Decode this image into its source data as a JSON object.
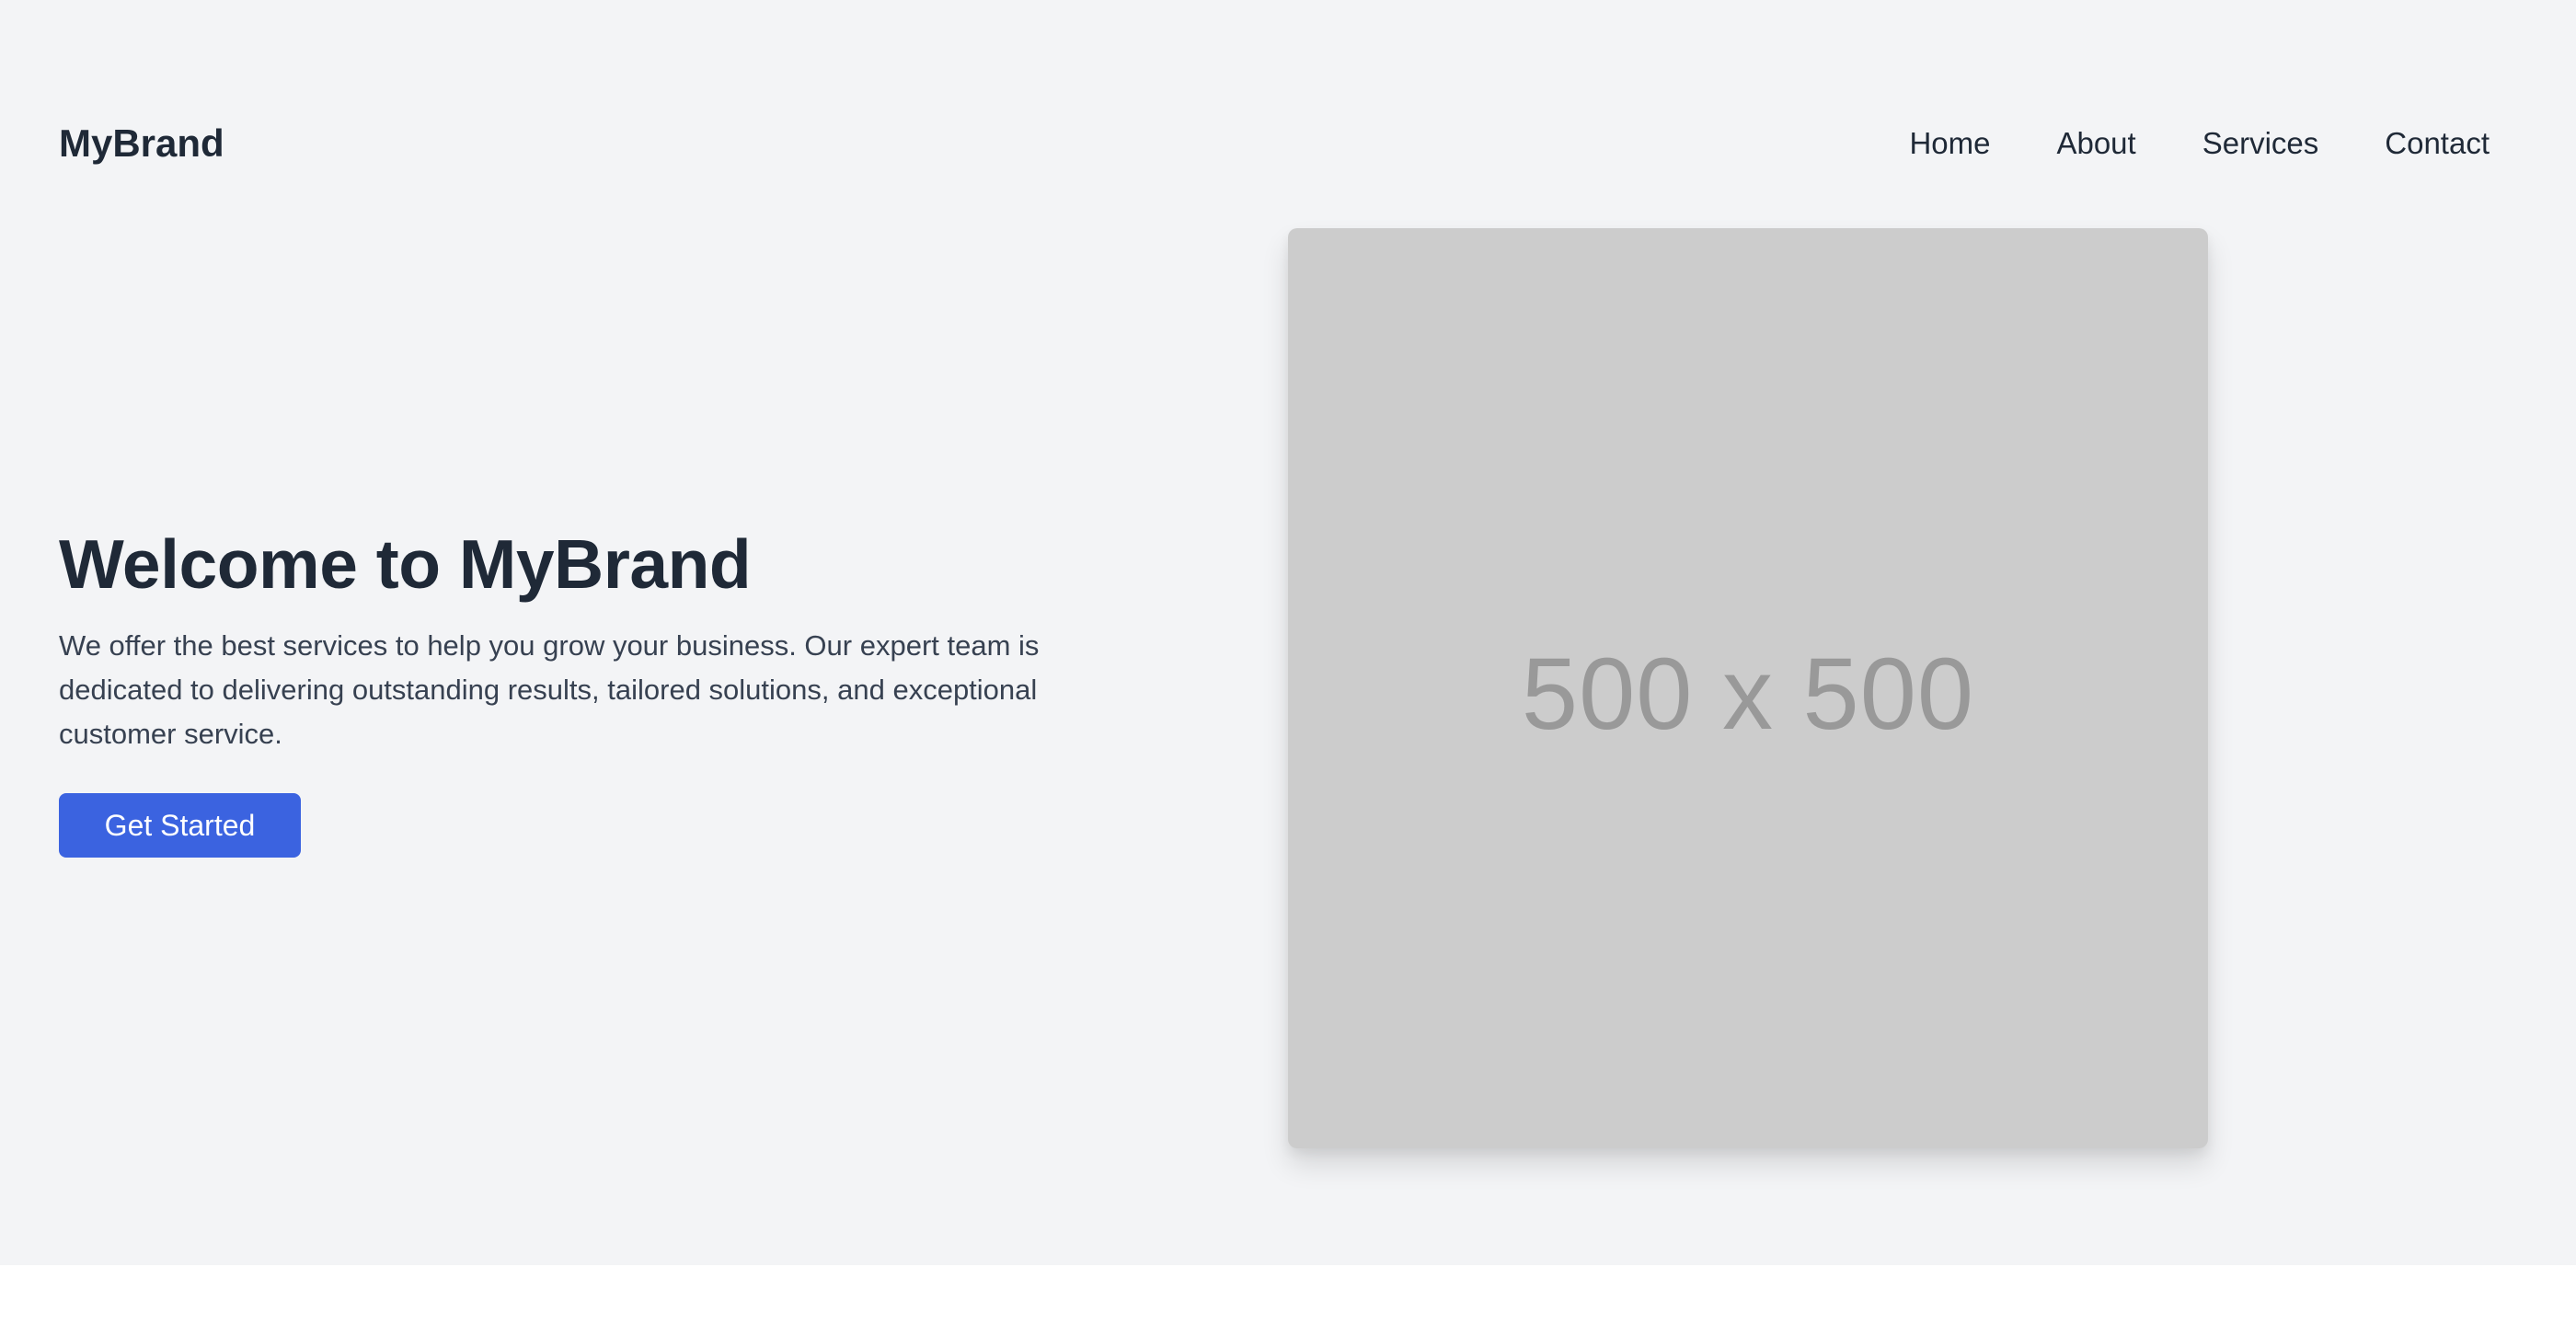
{
  "header": {
    "brand": "MyBrand",
    "nav": [
      {
        "label": "Home"
      },
      {
        "label": "About"
      },
      {
        "label": "Services"
      },
      {
        "label": "Contact"
      }
    ]
  },
  "hero": {
    "title": "Welcome to MyBrand",
    "description": "We offer the best services to help you grow your business. Our expert team is dedicated to delivering outstanding results, tailored solutions, and exceptional customer service.",
    "cta_label": "Get Started",
    "image_label": "500 x 500"
  },
  "colors": {
    "background": "#f3f4f6",
    "text_primary": "#1f2937",
    "accent": "#3b63e0",
    "placeholder_bg": "#cccccc",
    "placeholder_text": "#999999"
  }
}
